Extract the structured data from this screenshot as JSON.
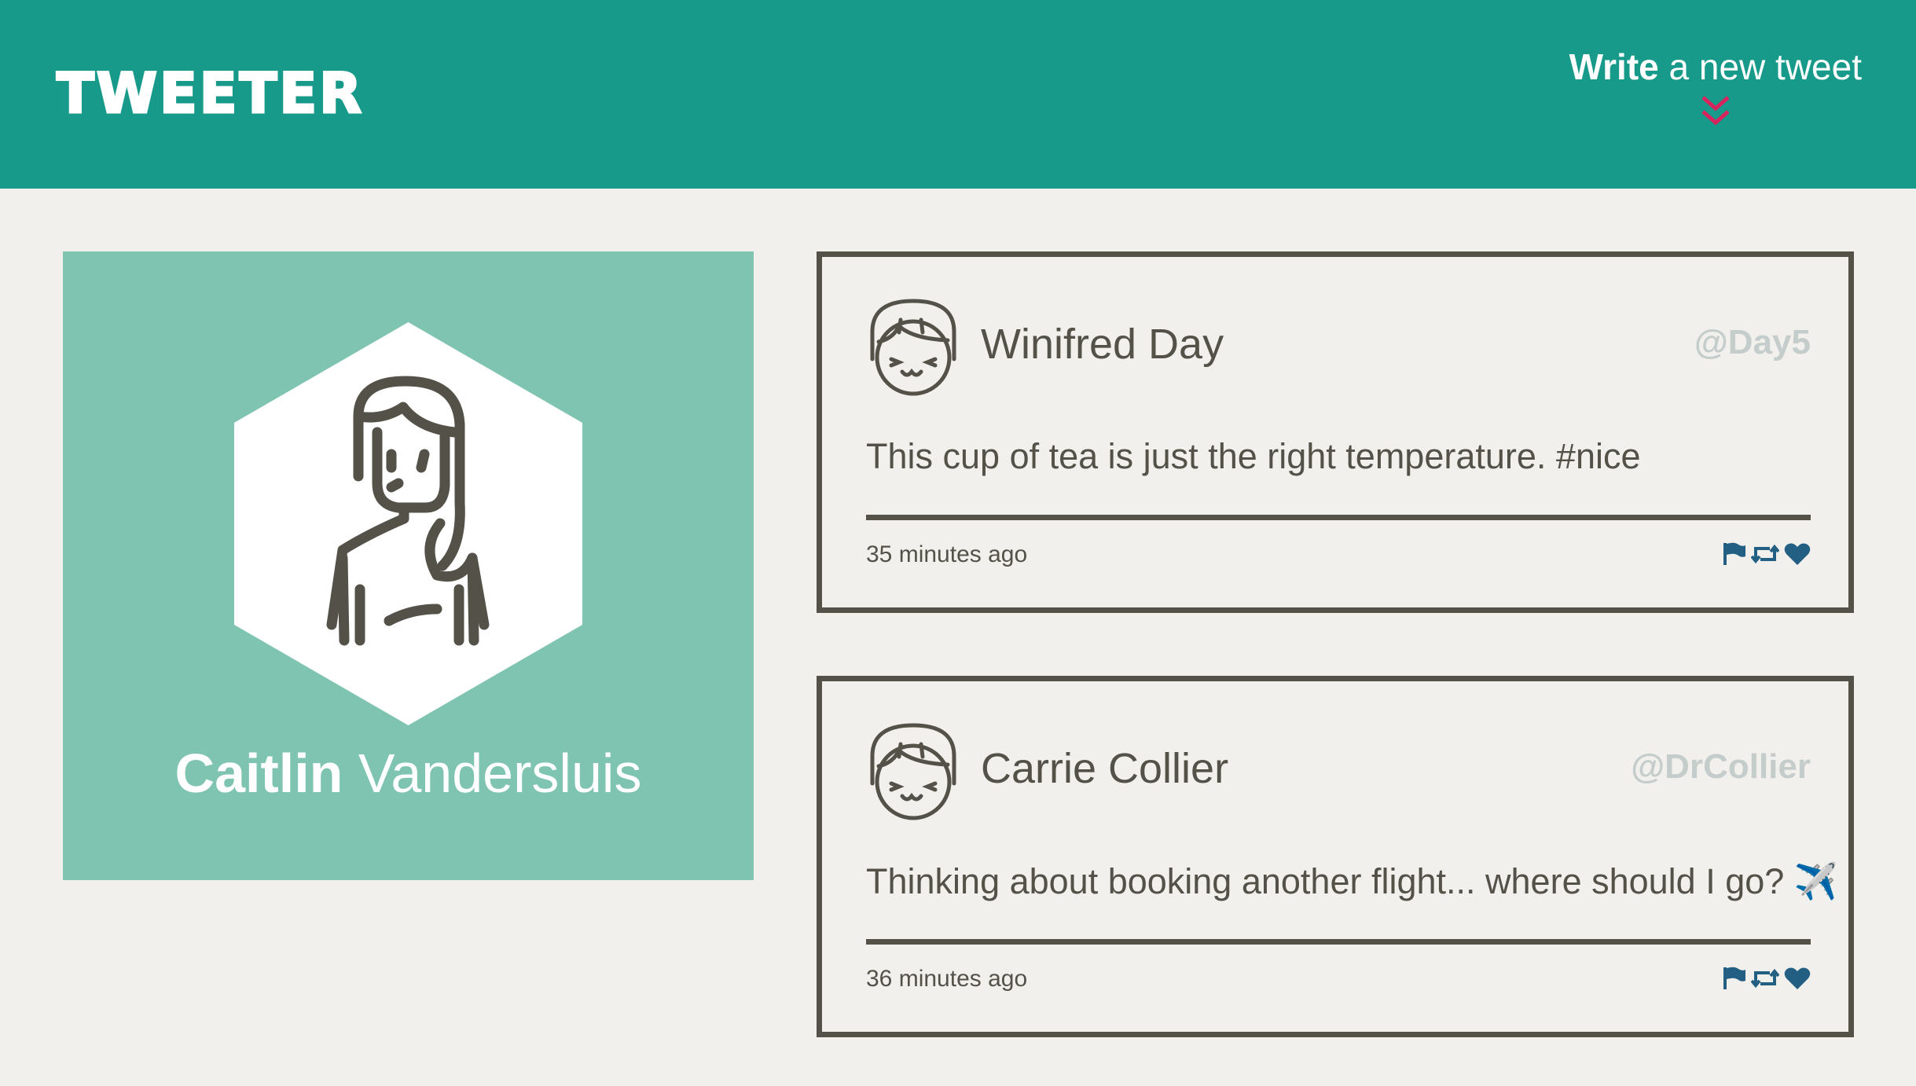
{
  "header": {
    "logo": "TWEETER",
    "compose_bold": "Write",
    "compose_rest": " a new tweet"
  },
  "profile": {
    "first_name": "Caitlin",
    "last_name": " Vandersluis"
  },
  "tweets": [
    {
      "name": "Winifred Day",
      "handle": "@Day5",
      "content": "This cup of tea is just the right temperature. #nice",
      "time": "35 minutes ago"
    },
    {
      "name": "Carrie Collier",
      "handle": "@DrCollier",
      "content": "Thinking about booking another flight... where should I go?",
      "emoji": "✈️",
      "time": "36 minutes ago"
    }
  ],
  "colors": {
    "header_bg": "#179a89",
    "profile_bg": "#7fc4b1",
    "page_bg": "#f2f0ec",
    "text": "#545149",
    "handle": "#c4cccc",
    "accent_chevron": "#d6245e",
    "action_icons": "#225f82"
  },
  "icons": [
    "chevrons-down-icon",
    "flag-icon",
    "retweet-icon",
    "heart-icon",
    "avatar-icon"
  ]
}
